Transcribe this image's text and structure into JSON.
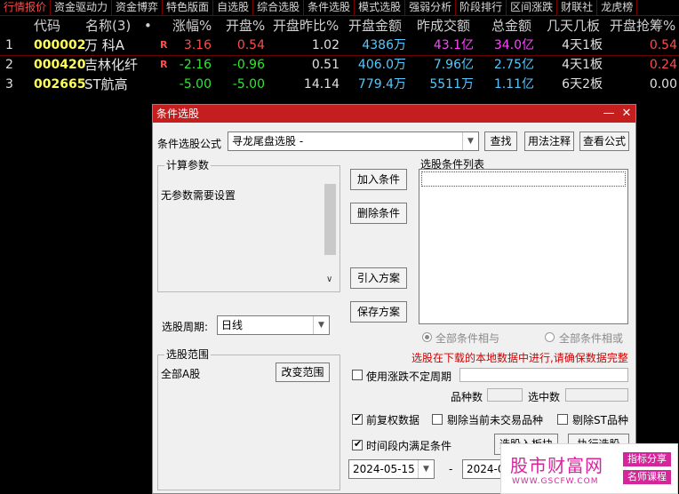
{
  "tabs": [
    "行情报价",
    "资金驱动力",
    "资金博弈",
    "特色版面",
    "自选股",
    "综合选股",
    "条件选股",
    "模式选股",
    "强弱分析",
    "阶段排行",
    "区间涨跌",
    "财联社",
    "龙虎榜"
  ],
  "headers": {
    "code": "代码",
    "name": "名称(3)",
    "dot": "•",
    "pct": "涨幅%",
    "open_pct": "开盘%",
    "open_ratio": "开盘昨比%",
    "open_amount": "开盘金额",
    "yesterday_amount": "昨成交额",
    "total_amount": "总金额",
    "days_boards": "几天几板",
    "open_grab": "开盘抢筹%"
  },
  "rows": [
    {
      "idx": "1",
      "code": "000002",
      "name": "万 科A",
      "flag": "R",
      "pct": "3.16",
      "open_pct": "0.54",
      "open_ratio": "1.02",
      "open_amount": "4386万",
      "yesterday_amount": "43.1亿",
      "total_amount": "34.0亿",
      "days_boards": "4天1板",
      "open_grab": "0.54"
    },
    {
      "idx": "2",
      "code": "000420",
      "name": "吉林化纤",
      "flag": "R",
      "pct": "-2.16",
      "open_pct": "-0.96",
      "open_ratio": "0.51",
      "open_amount": "406.0万",
      "yesterday_amount": "7.96亿",
      "total_amount": "2.75亿",
      "days_boards": "4天1板",
      "open_grab": "0.24"
    },
    {
      "idx": "3",
      "code": "002665",
      "name": "ST航高",
      "flag": "",
      "pct": "-5.00",
      "open_pct": "-5.00",
      "open_ratio": "14.14",
      "open_amount": "779.4万",
      "yesterday_amount": "5511万",
      "total_amount": "1.11亿",
      "days_boards": "6天2板",
      "open_grab": "0.00"
    }
  ],
  "dialog": {
    "title": "条件选股",
    "formula_label": "条件选股公式",
    "formula_value": "寻龙尾盘选股  -",
    "find_btn": "查找",
    "usage_btn": "用法注释",
    "view_btn": "查看公式",
    "params_title": "计算参数",
    "params_text": "无参数需要设置",
    "period_label": "选股周期:",
    "period_value": "日线",
    "add_btn": "加入条件",
    "delete_btn": "删除条件",
    "import_btn": "引入方案",
    "save_btn": "保存方案",
    "list_title": "选股条件列表",
    "radio_and": "全部条件相与",
    "radio_or": "全部条件相或",
    "warning": "选股在下载的本地数据中进行,请确保数据完整",
    "range_title": "选股范围",
    "range_value": "全部A股",
    "change_range_btn": "改变范围",
    "use_irregular": "使用涨跌不定周期",
    "stock_count_label": "品种数",
    "selected_count_label": "选中数",
    "fq_label": "前复权数据",
    "exclude_untraded": "剔除当前未交易品种",
    "exclude_st": "剔除ST品种",
    "time_range_label": "时间段内满足条件",
    "to_board_btn": "选股入板块",
    "execute_btn": "执行选股",
    "start_date": "2024-05-15",
    "dash": "-",
    "end_date": "2024-05-",
    "minimize": "—",
    "close": "✕"
  },
  "watermark": {
    "main": "股市财富网",
    "tag1": "指标分享",
    "tag2": "名师课程",
    "url": "WWW.GSCFW.COM"
  },
  "colors": {
    "up": "#ff4b4b",
    "down": "#2ee82e",
    "code": "#ffff55",
    "amount": "#55c8ff",
    "magenta": "#ff44ff",
    "warning": "#d40000",
    "title": "#c41e1e"
  }
}
